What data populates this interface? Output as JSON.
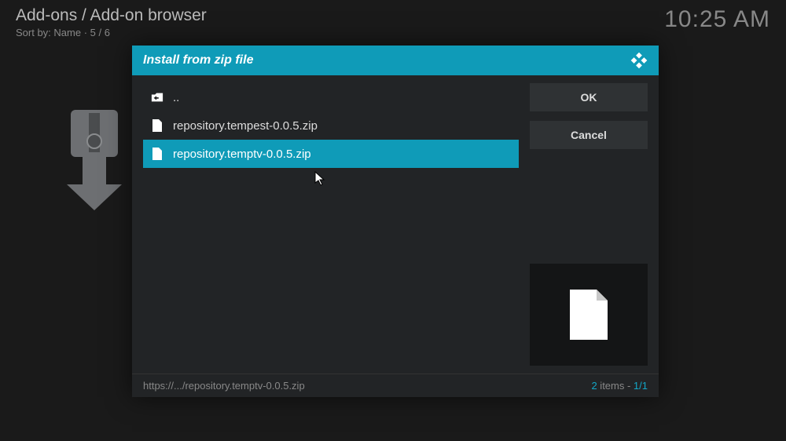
{
  "header": {
    "breadcrumb": "Add-ons / Add-on browser",
    "sort_label": "Sort by: Name",
    "sort_count": "5 / 6",
    "clock": "10:25 AM"
  },
  "dialog": {
    "title": "Install from zip file",
    "parent_label": "..",
    "files": [
      {
        "name": "repository.tempest-0.0.5.zip",
        "selected": false
      },
      {
        "name": "repository.temptv-0.0.5.zip",
        "selected": true
      }
    ],
    "buttons": {
      "ok": "OK",
      "cancel": "Cancel"
    },
    "footer": {
      "path": "https://.../repository.temptv-0.0.5.zip",
      "count_value": "2",
      "count_label": " items - ",
      "page": "1/1"
    }
  }
}
